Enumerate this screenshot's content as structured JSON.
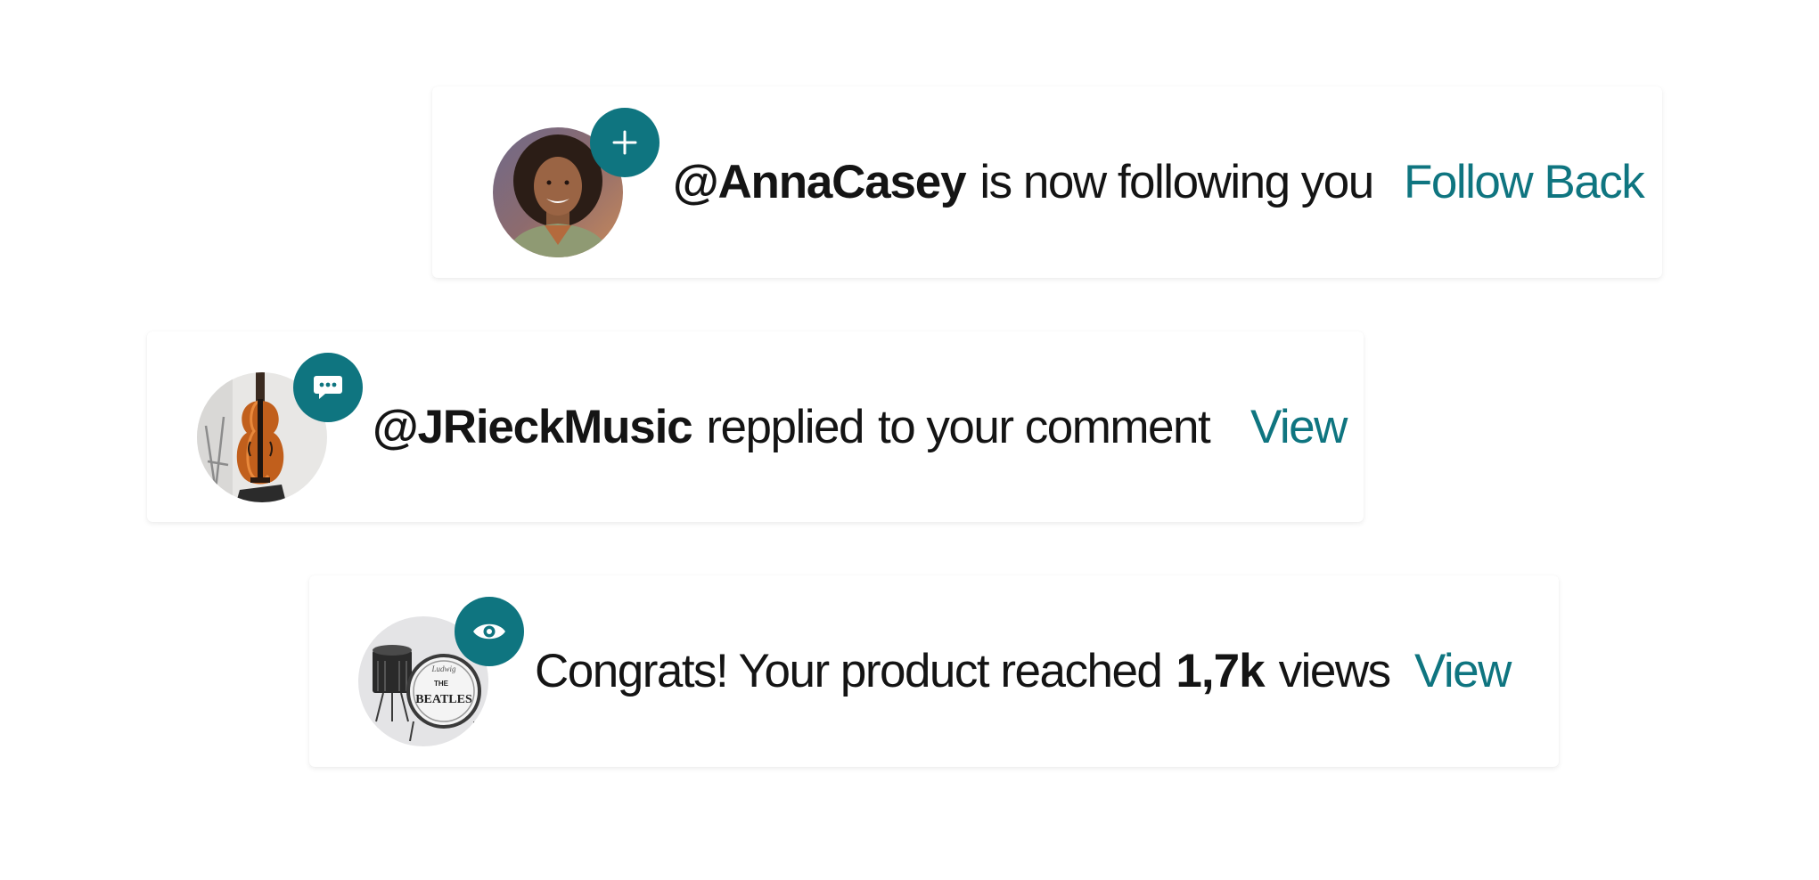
{
  "theme": {
    "accent": "#0f7580",
    "text": "#141414",
    "card_bg": "#ffffff"
  },
  "notifications": [
    {
      "type": "follow",
      "badge_icon": "plus-icon",
      "avatar": "woman-portrait",
      "handle": "@AnnaCasey",
      "message": "is now following you",
      "action_label": "Follow Back"
    },
    {
      "type": "reply",
      "badge_icon": "chat-bubble-icon",
      "avatar": "violin-photo",
      "handle": "@JRieckMusic",
      "message_part1": "repplied",
      "message_part2": "to your comment",
      "action_label": "View"
    },
    {
      "type": "views",
      "badge_icon": "eye-icon",
      "avatar": "drum-kit-photo",
      "message_prefix": "Congrats! Your product reached",
      "count": "1,7k",
      "message_suffix": "views",
      "action_label": "View",
      "drum_head_top": "Ludwig",
      "drum_head_line1": "THE",
      "drum_head_line2": "BEATLES"
    }
  ]
}
